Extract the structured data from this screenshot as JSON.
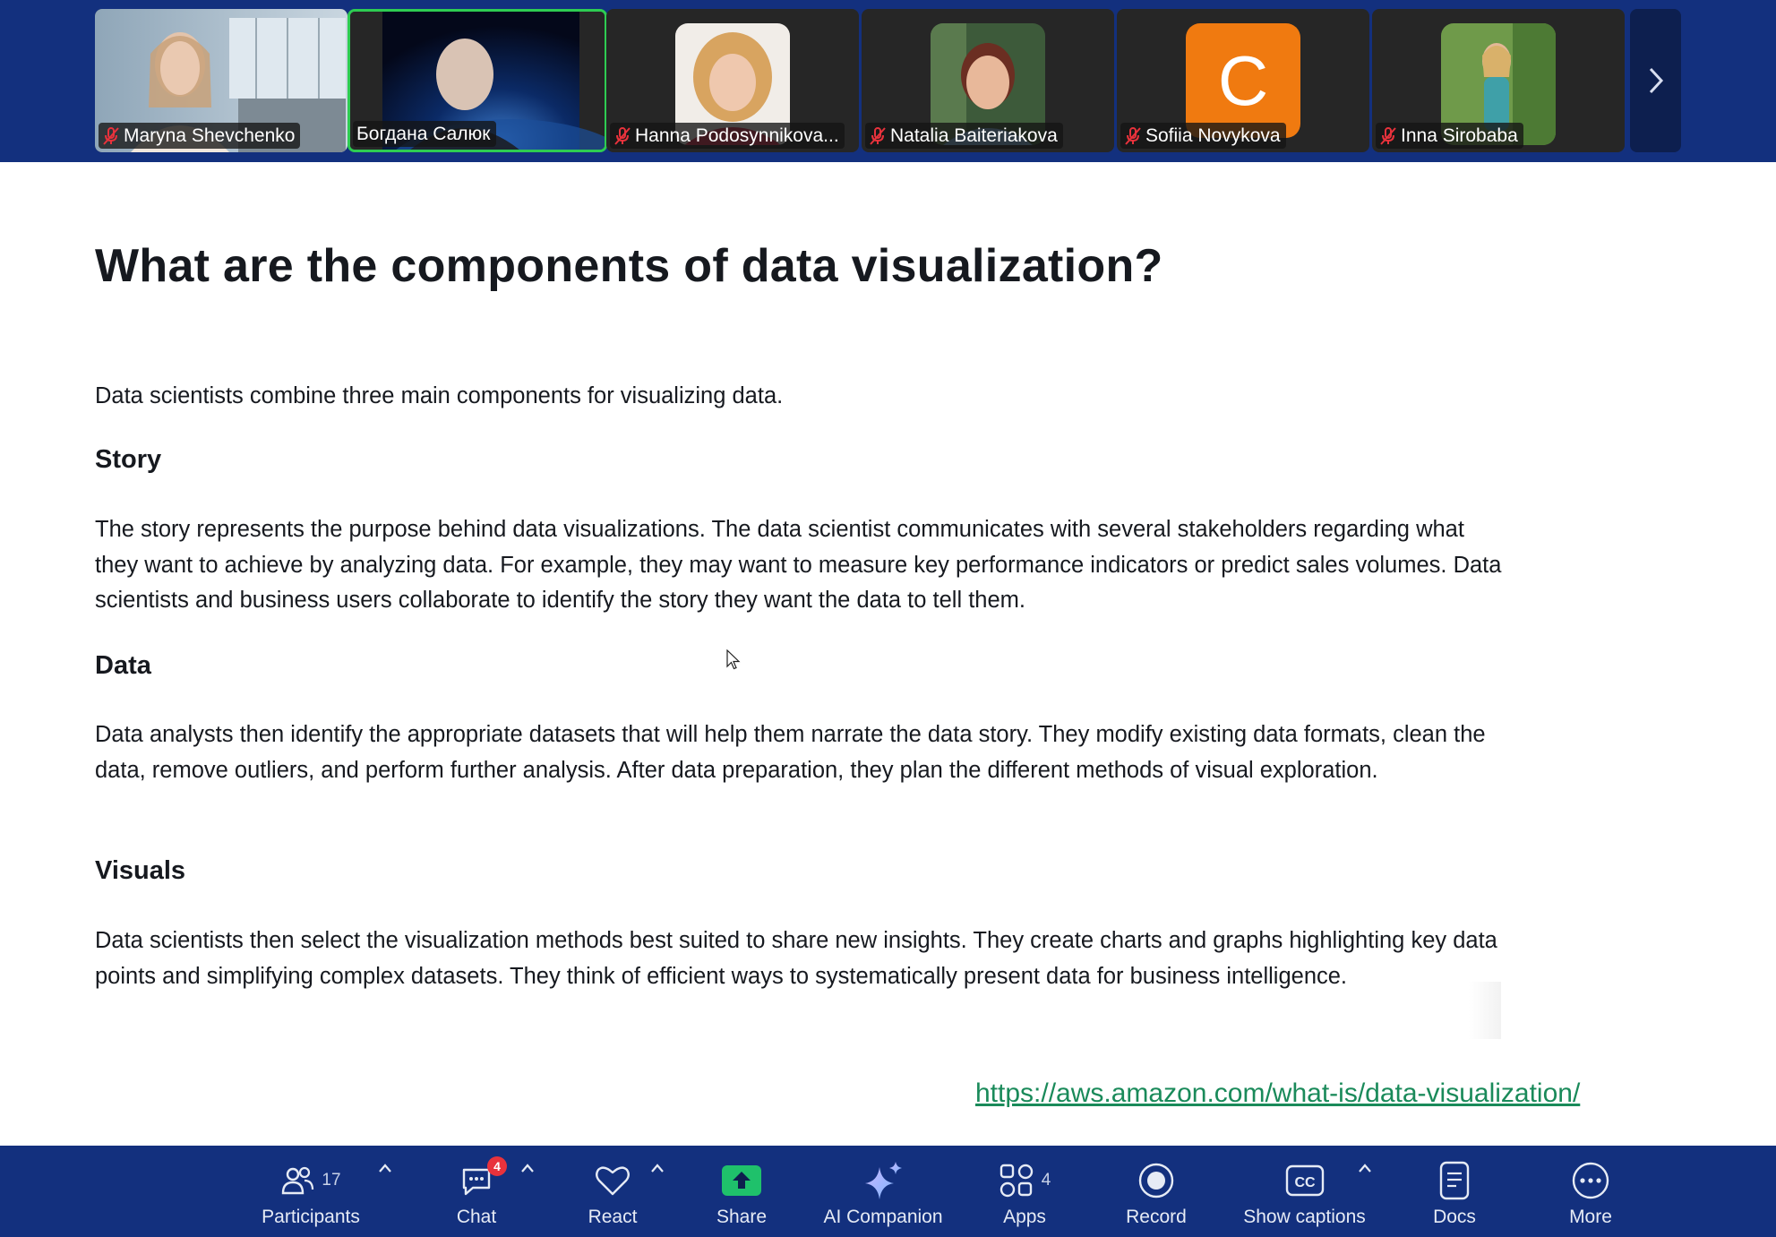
{
  "participants_strip": {
    "tiles": [
      {
        "name": "Maryna Shevchenko",
        "muted": true
      },
      {
        "name": "Богдана Салюк",
        "muted": false,
        "active_speaker": true
      },
      {
        "name": "Hanna Podosynnikova...",
        "muted": true
      },
      {
        "name": "Natalia Baiteriakova",
        "muted": true
      },
      {
        "name": "Sofiia Novykova",
        "muted": true,
        "avatar_letter": "C"
      },
      {
        "name": "Inna Sirobaba",
        "muted": true
      }
    ],
    "next_icon": "chevron-right-icon"
  },
  "shared_content": {
    "title": "What are the components of data visualization?",
    "intro": "Data scientists combine three main components for visualizing data.",
    "sections": [
      {
        "heading": "Story",
        "body": "The story represents the purpose behind data visualizations. The data scientist communicates with several stakeholders regarding what they want to achieve by analyzing data. For example, they may want to measure key performance indicators or predict sales volumes. Data scientists and business users collaborate to identify the story they want the data to tell them."
      },
      {
        "heading": "Data",
        "body": "Data analysts then identify the appropriate datasets that will help them narrate the data story. They modify existing data formats, clean the data, remove outliers, and perform further analysis. After data preparation, they plan the different methods of visual exploration."
      },
      {
        "heading": "Visuals",
        "body": "Data scientists then select the visualization methods best suited to share new insights. They create charts and graphs highlighting key data points and simplifying complex datasets. They think of efficient ways to systematically present data for business intelligence."
      }
    ],
    "source_link": "https://aws.amazon.com/what-is/data-visualization/"
  },
  "toolbar": {
    "participants": {
      "label": "Participants",
      "count": "17"
    },
    "chat": {
      "label": "Chat",
      "badge": "4"
    },
    "react": {
      "label": "React"
    },
    "share": {
      "label": "Share"
    },
    "ai_companion": {
      "label": "AI Companion"
    },
    "apps": {
      "label": "Apps",
      "count": "4"
    },
    "record": {
      "label": "Record"
    },
    "captions": {
      "label": "Show captions"
    },
    "docs": {
      "label": "Docs"
    },
    "more": {
      "label": "More"
    }
  },
  "colors": {
    "toolbar_bg": "#13307e",
    "share_green": "#1fc16b",
    "active_border": "#2ecc52",
    "link_green": "#1a8a5a",
    "mic_off_red": "#e8323c",
    "avatar_orange": "#f07a10"
  }
}
